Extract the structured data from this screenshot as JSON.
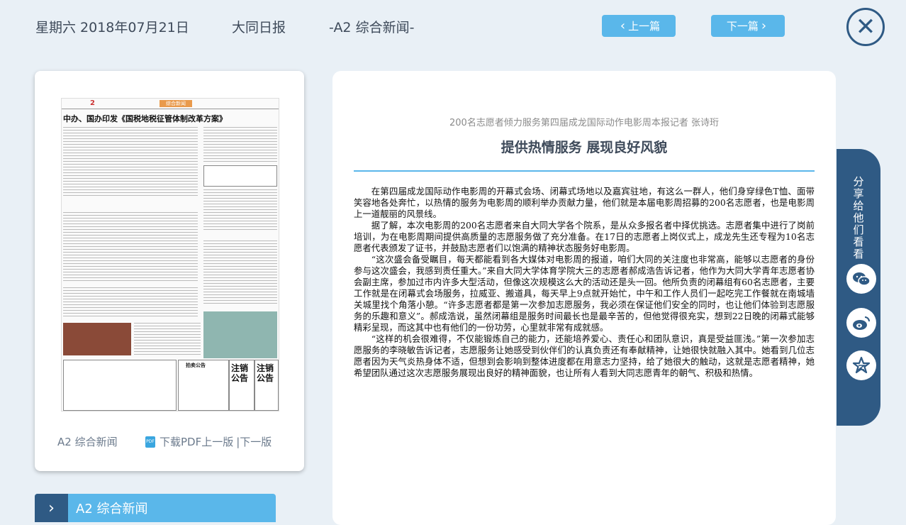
{
  "header": {
    "date": "星期六 2018年07月21日",
    "paper": "大同日报",
    "edition": "-A2 综合新闻-",
    "prev_label": "上一篇",
    "next_label": "下一篇"
  },
  "thumbnail": {
    "page_no": "2",
    "section_tag": "综合新闻",
    "headline": "中办、国办印发《国税地税征管体制改革方案》",
    "notices": [
      "注销公告",
      "注销公告",
      "拍卖公告"
    ],
    "edition_label": "A2 综合新闻",
    "pdf_label": "下载PDF",
    "prev_page": "上一版",
    "next_page": "|下一版"
  },
  "section": {
    "label": "A2  综合新闻"
  },
  "article": {
    "subtitle": "200名志愿者倾力服务第四届成龙国际动作电影周本报记者 张诗珩",
    "title": "提供热情服务 展现良好风貌",
    "paragraphs": [
      "在第四届成龙国际动作电影周的开幕式会场、闭幕式场地以及嘉宾驻地，有这么一群人，他们身穿绿色T恤、面带笑容地各处奔忙，以热情的服务为电影周的顺利举办贡献力量，他们就是本届电影周招募的200名志愿者，也是电影周上一道靓丽的风景线。",
      "据了解，本次电影周的200名志愿者来自大同大学各个院系，是从众多报名者中择优挑选。志愿者集中进行了岗前培训，为在电影周期间提供高质量的志愿服务做了充分准备。在17日的志愿者上岗仪式上，成龙先生还专程为10名志愿者代表颁发了证书，并鼓励志愿者们以饱满的精神状态服务好电影周。",
      "“这次盛会备受瞩目，每天都能看到各大媒体对电影周的报道，咱们大同的关注度也非常高，能够以志愿者的身份参与这次盛会，我感到责任重大。”来自大同大学体育学院大三的志愿者郝成浩告诉记者，他作为大同大学青年志愿者协会副主席，参加过市内许多大型活动，但像这次规模这么大的活动还是头一回。他所负责的闭幕组有60名志愿者，主要工作就是在闭幕式会场服务，拉威亚、搬道具，每天早上9点就开始忙，中午和工作人员们一起吃完工作餐就在南城墙关城里找个角落小憩。“许多志愿者都是第一次参加志愿服务，我必须在保证他们安全的同时，也让他们体验到志愿服务的乐趣和意义”。郝成浩说，虽然闭幕组是服务时间最长也是最辛苦的，但他觉得很充实，想到22日晚的闭幕式能够精彩呈现，而这其中也有他们的一份功劳，心里就非常有成就感。",
      "“这样的机会很难得，不仅能锻炼自己的能力，还能培养爱心、责任心和团队意识，真是受益匪浅。”第一次参加志愿服务的李晓敏告诉记者，志愿服务让她感受到伙伴们的认真负责还有奉献精神，让她很快就融入其中。她看到几位志愿者因为天气炎热身体不适，但想到会影响到整体进度都在用意志力坚持，给了她很大的触动，这就是志愿者精神，她希望团队通过这次志愿服务展现出良好的精神面貌，也让所有人看到大同志愿青年的朝气、积极和热情。"
    ]
  },
  "share": {
    "label": "分享给他们看看"
  },
  "icons": {
    "prev": "chevron-left-icon",
    "next": "chevron-right-icon",
    "close": "close-icon",
    "pdf": "pdf-icon",
    "wechat": "wechat-icon",
    "weibo": "weibo-icon",
    "favorite": "star-icon"
  },
  "colors": {
    "accent": "#5ab7ea",
    "dark": "#2f5a84",
    "background": "#e9f0f6"
  }
}
